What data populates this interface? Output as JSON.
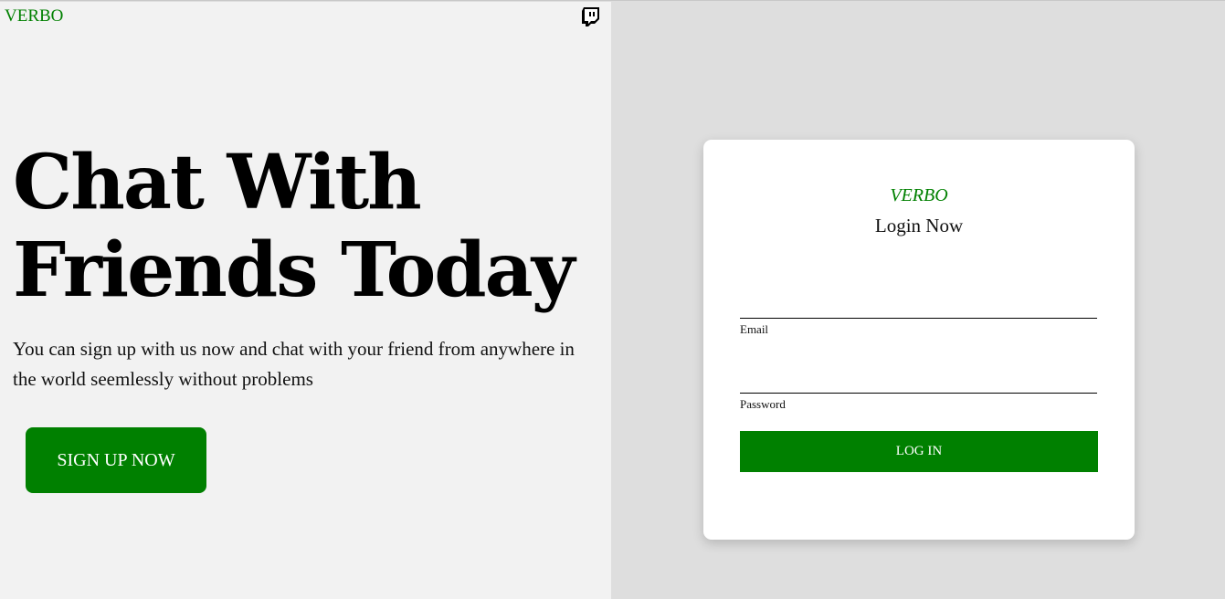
{
  "header": {
    "brand": "VERBO",
    "social_icon": "twitch-icon"
  },
  "hero": {
    "title": "Chat With Friends Today",
    "subtitle": "You can sign up with us now and chat with your friend from anywhere in the world seemlessly without problems",
    "signup_label": "SIGN UP NOW"
  },
  "login": {
    "brand": "VERBO",
    "title": "Login Now",
    "email_label": "Email",
    "email_value": "",
    "password_label": "Password",
    "password_value": "",
    "submit_label": "LOG IN"
  },
  "colors": {
    "accent": "#008000",
    "left_bg": "#f2f2f2",
    "right_bg": "#dedede",
    "card_bg": "#ffffff"
  }
}
